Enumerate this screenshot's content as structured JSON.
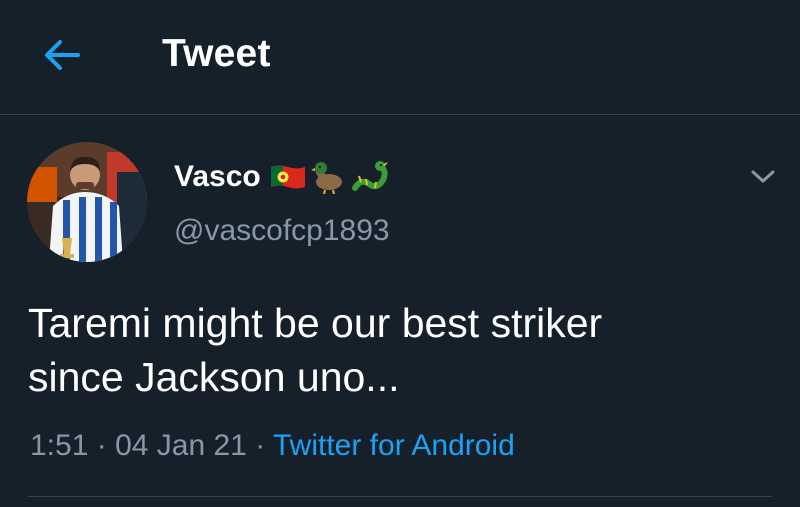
{
  "header": {
    "title": "Tweet",
    "back_icon": "arrow-left-icon"
  },
  "tweet": {
    "author_name": "Vasco",
    "name_emojis": [
      "portugal-flag-icon",
      "duck-icon",
      "dragon-icon"
    ],
    "handle": "@vascofcp1893",
    "text": "Taremi might be our best striker\nsince Jackson uno...",
    "time": "1:51",
    "date": "04 Jan 21",
    "separator": "·",
    "source": "Twitter for Android"
  },
  "colors": {
    "background": "#15202b",
    "accent": "#1da1f2",
    "secondary_text": "#8899a6",
    "divider": "#38444d"
  }
}
